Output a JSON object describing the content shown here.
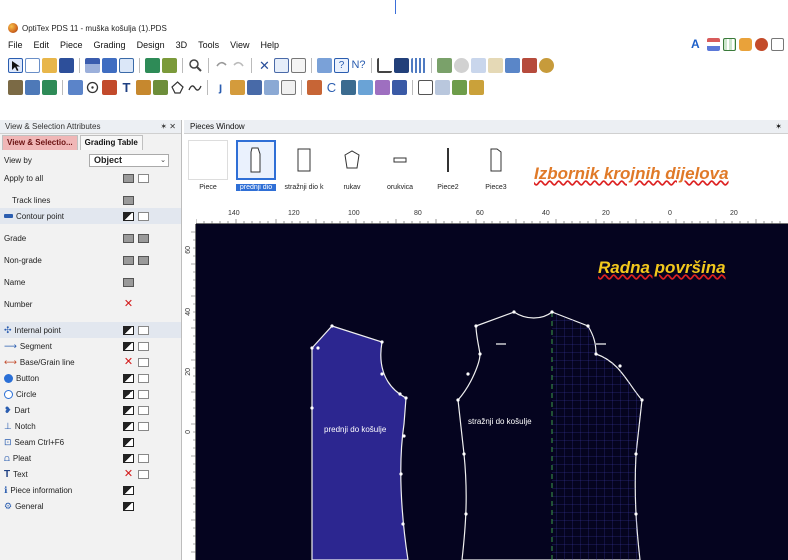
{
  "window": {
    "title": "OptiTex PDS 11 - muška košulja (1).PDS"
  },
  "menu": [
    "File",
    "Edit",
    "Piece",
    "Grading",
    "Design",
    "3D",
    "Tools",
    "View",
    "Help"
  ],
  "left_panel": {
    "title": "View & Selection Attributes",
    "pin": "✶ ✕",
    "tabs": [
      "View & Selectio...",
      "Grading Table"
    ],
    "view_by_label": "View by",
    "view_by_value": "Object",
    "rows": [
      "Apply to all",
      "Track lines",
      "Contour point",
      "Grade",
      "Non-grade",
      "Name",
      "Number",
      "Internal point",
      "Segment",
      "Base/Grain line",
      "Button",
      "Circle",
      "Dart",
      "Notch",
      "Seam  Ctrl+F6",
      "Pleat",
      "Text",
      "Piece information",
      "General"
    ]
  },
  "pieces_window": {
    "title": "Pieces Window",
    "pin": "✶",
    "items": [
      "Piece",
      "prednji dio",
      "stražnji dio k",
      "rukav",
      "orukvica",
      "Piece2",
      "Piece3"
    ],
    "selected": "prednji dio",
    "annotation": "Izbornik krojnih dijelova"
  },
  "workspace": {
    "annotation": "Radna površina",
    "piece_labels": [
      "prednji do košulje",
      "stražnji do košulje"
    ],
    "ruler_top": [
      "140",
      "120",
      "100",
      "80",
      "60",
      "40",
      "20",
      "0",
      "20"
    ],
    "ruler_left": [
      "60",
      "40",
      "20",
      "0"
    ]
  }
}
